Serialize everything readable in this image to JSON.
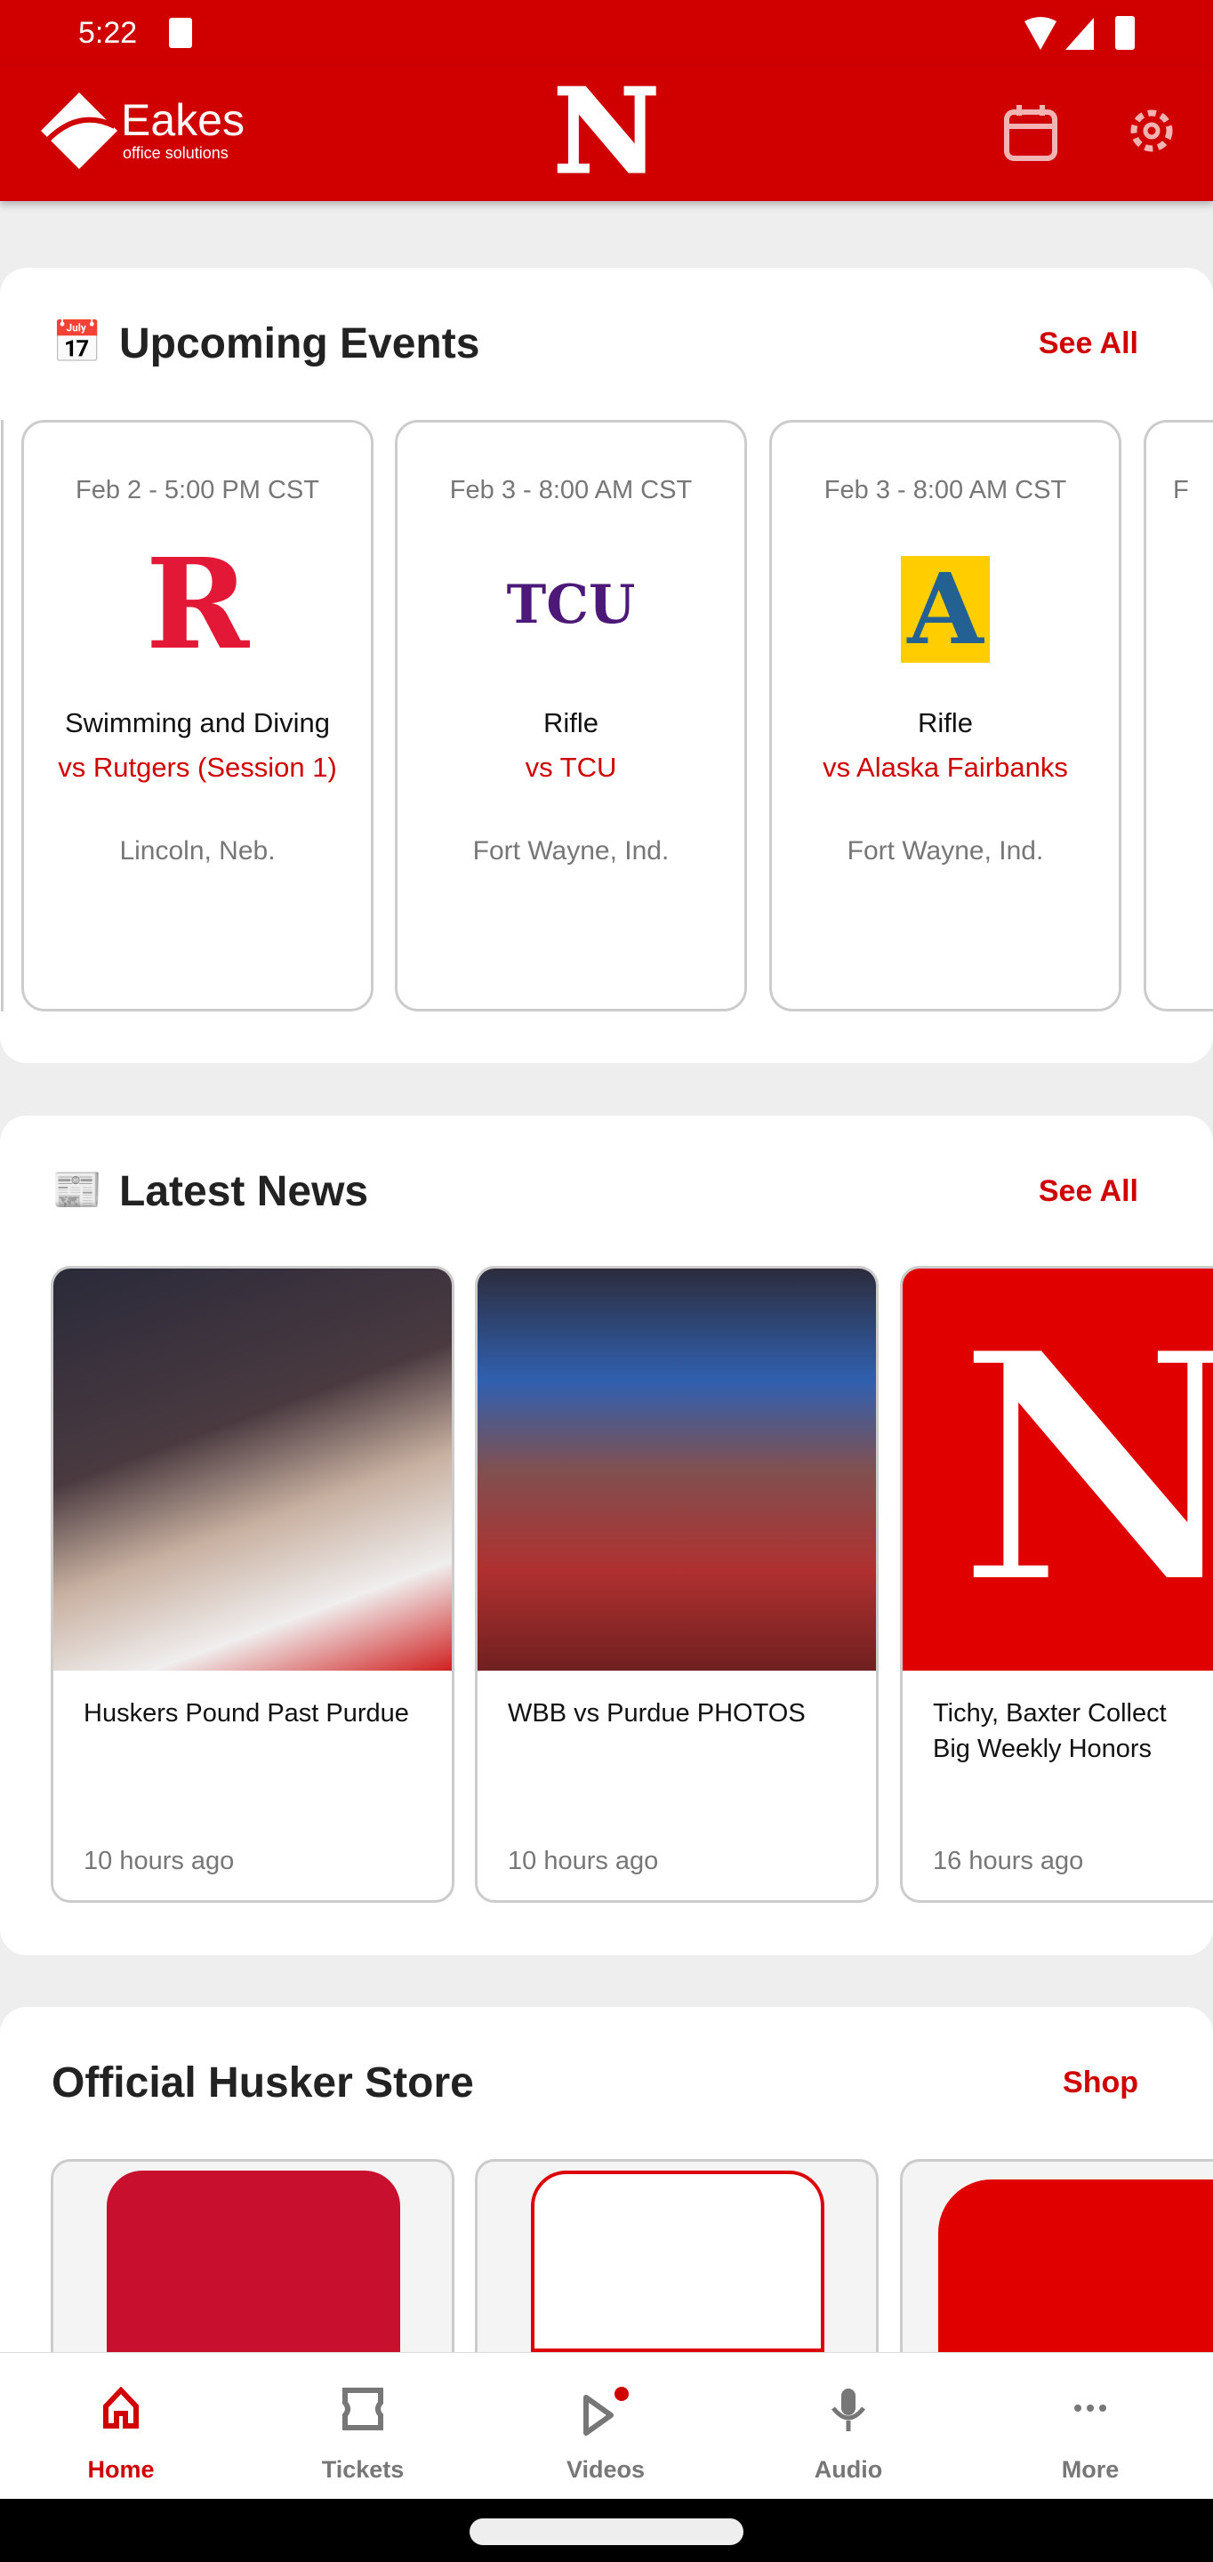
{
  "status": {
    "time": "5:22"
  },
  "header": {
    "sponsor_logo": "Eakes office solutions",
    "team_logo": "N",
    "icons": [
      "calendar-icon",
      "gear-icon"
    ]
  },
  "events": {
    "icon": "calendar-icon",
    "title": "Upcoming Events",
    "see_all": "See All",
    "items": [
      {
        "date": "Feb 2 - 5:00 PM CST",
        "logo": "R",
        "sport": "Swimming and Diving",
        "opponent": "vs Rutgers (Session 1)",
        "location": "Lincoln, Neb."
      },
      {
        "date": "Feb 3 - 8:00 AM CST",
        "logo": "TCU",
        "sport": "Rifle",
        "opponent": "vs TCU",
        "location": "Fort Wayne, Ind."
      },
      {
        "date": "Feb 3 - 8:00 AM CST",
        "logo": "A",
        "sport": "Rifle",
        "opponent": "vs Alaska Fairbanks",
        "location": "Fort Wayne, Ind."
      },
      {
        "date": "F"
      }
    ]
  },
  "news": {
    "icon": "newspaper-icon",
    "title": "Latest News",
    "see_all": "See All",
    "items": [
      {
        "title": "Huskers Pound Past Purdue",
        "ago": "10 hours ago"
      },
      {
        "title": "WBB vs Purdue PHOTOS",
        "ago": "10 hours ago"
      },
      {
        "title": "Tichy, Baxter Collect Big Weekly Honors",
        "ago": "16 hours ago"
      }
    ]
  },
  "store": {
    "title": "Official Husker Store",
    "shop": "Shop"
  },
  "nav": {
    "active": "Home",
    "items": [
      {
        "label": "Home",
        "icon": "home-icon"
      },
      {
        "label": "Tickets",
        "icon": "ticket-icon"
      },
      {
        "label": "Videos",
        "icon": "play-icon"
      },
      {
        "label": "Audio",
        "icon": "microphone-icon"
      },
      {
        "label": "More",
        "icon": "more-icon"
      }
    ]
  },
  "colors": {
    "brand": "#d00000",
    "muted": "#777777"
  }
}
